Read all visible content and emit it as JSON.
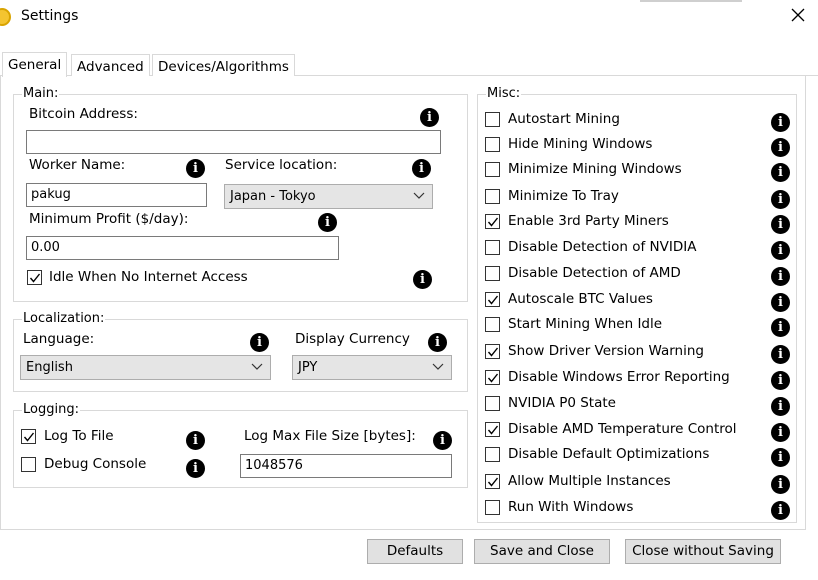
{
  "window": {
    "title": "Settings",
    "close_label": "✕"
  },
  "tabs": [
    {
      "label": "General",
      "active": true
    },
    {
      "label": "Advanced",
      "active": false
    },
    {
      "label": "Devices/Algorithms",
      "active": false
    }
  ],
  "main": {
    "legend": "Main:",
    "bitcoin_label": "Bitcoin Address:",
    "bitcoin_value": "",
    "worker_label": "Worker Name:",
    "worker_value": "pakug",
    "service_label": "Service location:",
    "service_value": "Japan - Tokyo",
    "minprofit_label": "Minimum Profit ($/day):",
    "minprofit_value": "0.00",
    "idle_label": "Idle When No Internet Access",
    "idle_checked": true
  },
  "localization": {
    "legend": "Localization:",
    "language_label": "Language:",
    "language_value": "English",
    "currency_label": "Display Currency",
    "currency_value": "JPY"
  },
  "logging": {
    "legend": "Logging:",
    "log_to_file_label": "Log To File",
    "log_to_file_checked": true,
    "debug_label": "Debug Console",
    "debug_checked": false,
    "max_size_label": "Log Max File Size [bytes]:",
    "max_size_value": "1048576"
  },
  "misc": {
    "legend": "Misc:",
    "items": [
      {
        "label": "Autostart Mining",
        "checked": false
      },
      {
        "label": "Hide Mining Windows",
        "checked": false
      },
      {
        "label": "Minimize Mining Windows",
        "checked": false
      },
      {
        "label": "Minimize To Tray",
        "checked": false
      },
      {
        "label": "Enable 3rd Party Miners",
        "checked": true
      },
      {
        "label": "Disable Detection of NVIDIA",
        "checked": false
      },
      {
        "label": "Disable Detection of AMD",
        "checked": false
      },
      {
        "label": "Autoscale BTC Values",
        "checked": true
      },
      {
        "label": "Start Mining When Idle",
        "checked": false
      },
      {
        "label": "Show Driver Version Warning",
        "checked": true
      },
      {
        "label": "Disable Windows Error Reporting",
        "checked": true
      },
      {
        "label": "NVIDIA P0 State",
        "checked": false
      },
      {
        "label": "Disable AMD Temperature Control",
        "checked": true
      },
      {
        "label": "Disable Default Optimizations",
        "checked": false
      },
      {
        "label": "Allow Multiple Instances",
        "checked": true
      },
      {
        "label": "Run With Windows",
        "checked": false
      }
    ]
  },
  "buttons": {
    "defaults": "Defaults",
    "save_close": "Save and Close",
    "close_no_save": "Close without Saving"
  },
  "colors": {
    "app_icon": "#f4c430",
    "info_icon": "#000000"
  },
  "info_glyph": "i"
}
